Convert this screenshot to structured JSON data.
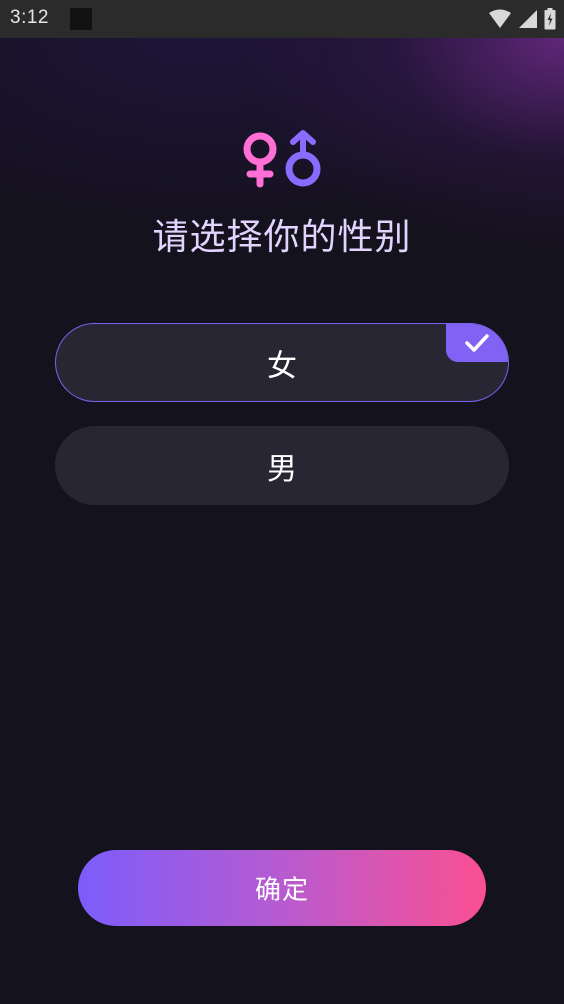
{
  "status_bar": {
    "time": "3:12",
    "icons": [
      "notification-icon",
      "wifi-icon",
      "signal-icon",
      "battery-icon"
    ]
  },
  "header": {
    "logo_icon": "gender-symbols-icon",
    "title": "请选择你的性别"
  },
  "options": [
    {
      "label": "女",
      "selected": true
    },
    {
      "label": "男",
      "selected": false
    }
  ],
  "confirm": {
    "label": "确定"
  },
  "colors": {
    "background": "#14121d",
    "option_bg": "#272632",
    "accent_purple": "#7a62f0",
    "female_pink": "#ff6fd6",
    "male_purple": "#8a6bff",
    "title_color": "#e2d4ff",
    "button_gradient_start": "#7d5cfb",
    "button_gradient_end": "#fb4f92"
  }
}
